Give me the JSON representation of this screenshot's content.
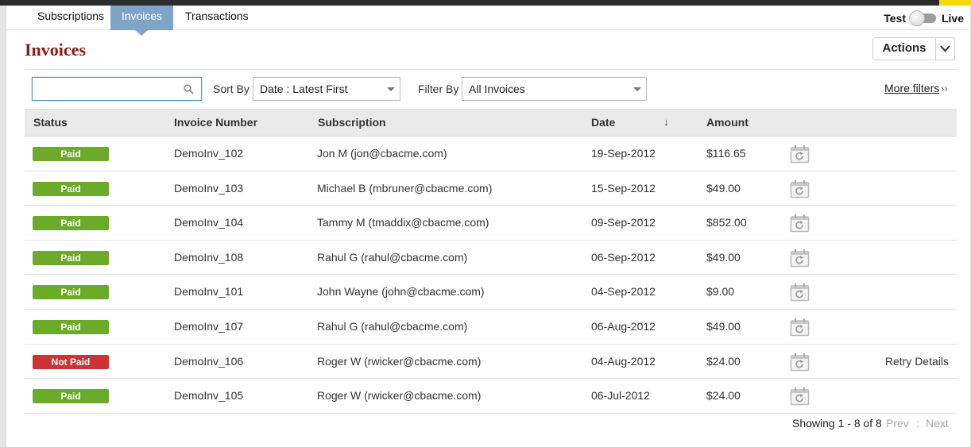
{
  "tabs": [
    {
      "label": "Subscriptions"
    },
    {
      "label": "Invoices"
    },
    {
      "label": "Transactions"
    }
  ],
  "mode": {
    "test_label": "Test",
    "live_label": "Live"
  },
  "page_title": "Invoices",
  "actions_label": "Actions",
  "search": {
    "value": "",
    "placeholder": ""
  },
  "sort": {
    "label": "Sort By",
    "value": "Date : Latest First"
  },
  "filter": {
    "label": "Filter By",
    "value": "All Invoices"
  },
  "more_filters": {
    "label": "More filters",
    "arrow": "››"
  },
  "columns": {
    "status": "Status",
    "invoice_number": "Invoice Number",
    "subscription": "Subscription",
    "date": "Date",
    "amount": "Amount",
    "sort_indicator": "↓"
  },
  "rows": [
    {
      "status": "Paid",
      "invoice": "DemoInv_102",
      "subscription": "Jon M (jon@cbacme.com)",
      "date": "19-Sep-2012",
      "amount": "$116.65",
      "action": ""
    },
    {
      "status": "Paid",
      "invoice": "DemoInv_103",
      "subscription": "Michael B (mbruner@cbacme.com)",
      "date": "15-Sep-2012",
      "amount": "$49.00",
      "action": ""
    },
    {
      "status": "Paid",
      "invoice": "DemoInv_104",
      "subscription": "Tammy M (tmaddix@cbacme.com)",
      "date": "09-Sep-2012",
      "amount": "$852.00",
      "action": ""
    },
    {
      "status": "Paid",
      "invoice": "DemoInv_108",
      "subscription": "Rahul G (rahul@cbacme.com)",
      "date": "06-Sep-2012",
      "amount": "$49.00",
      "action": ""
    },
    {
      "status": "Paid",
      "invoice": "DemoInv_101",
      "subscription": "John Wayne (john@cbacme.com)",
      "date": "04-Sep-2012",
      "amount": "$9.00",
      "action": ""
    },
    {
      "status": "Paid",
      "invoice": "DemoInv_107",
      "subscription": "Rahul G (rahul@cbacme.com)",
      "date": "06-Aug-2012",
      "amount": "$49.00",
      "action": ""
    },
    {
      "status": "Not Paid",
      "invoice": "DemoInv_106",
      "subscription": "Roger W (rwicker@cbacme.com)",
      "date": "04-Aug-2012",
      "amount": "$24.00",
      "action": "Retry Details"
    },
    {
      "status": "Paid",
      "invoice": "DemoInv_105",
      "subscription": "Roger W (rwicker@cbacme.com)",
      "date": "06-Jul-2012",
      "amount": "$24.00",
      "action": ""
    }
  ],
  "pagination": {
    "showing": "Showing 1 - 8 of 8",
    "prev": "Prev",
    "separator": ":",
    "next": "Next"
  },
  "colors": {
    "paid": "#6caa2a",
    "not_paid": "#cc3333",
    "active_tab": "#7fa4c7",
    "title": "#8b1a12"
  },
  "icons": {
    "search": "search-icon",
    "dropdown": "chevron-down-icon",
    "row_action": "calendar-refresh-icon"
  }
}
